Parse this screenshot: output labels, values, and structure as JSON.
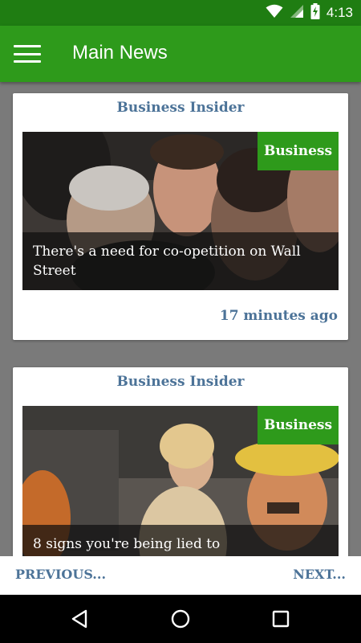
{
  "status_bar": {
    "time": "4:13",
    "icons": [
      "wifi-icon",
      "cell-signal-icon",
      "battery-charging-icon"
    ]
  },
  "app_bar": {
    "title": "Main News",
    "menu_icon": "hamburger-menu-icon"
  },
  "articles": [
    {
      "source": "Business Insider",
      "category": "Business",
      "headline": "There's a need for co-opetition on Wall Street",
      "time_ago": "17 minutes ago"
    },
    {
      "source": "Business Insider",
      "category": "Business",
      "headline": "8 signs you're being lied to",
      "time_ago": ""
    }
  ],
  "pager": {
    "previous_label": "PREVIOUS...",
    "next_label": "NEXT..."
  },
  "nav_bar": {
    "icons": [
      "back-icon",
      "home-icon",
      "recents-icon"
    ]
  },
  "colors": {
    "status_bar": "#1f7d12",
    "app_bar": "#2e9a1b",
    "accent_text": "#4c7398",
    "background": "#7a7a7a"
  }
}
